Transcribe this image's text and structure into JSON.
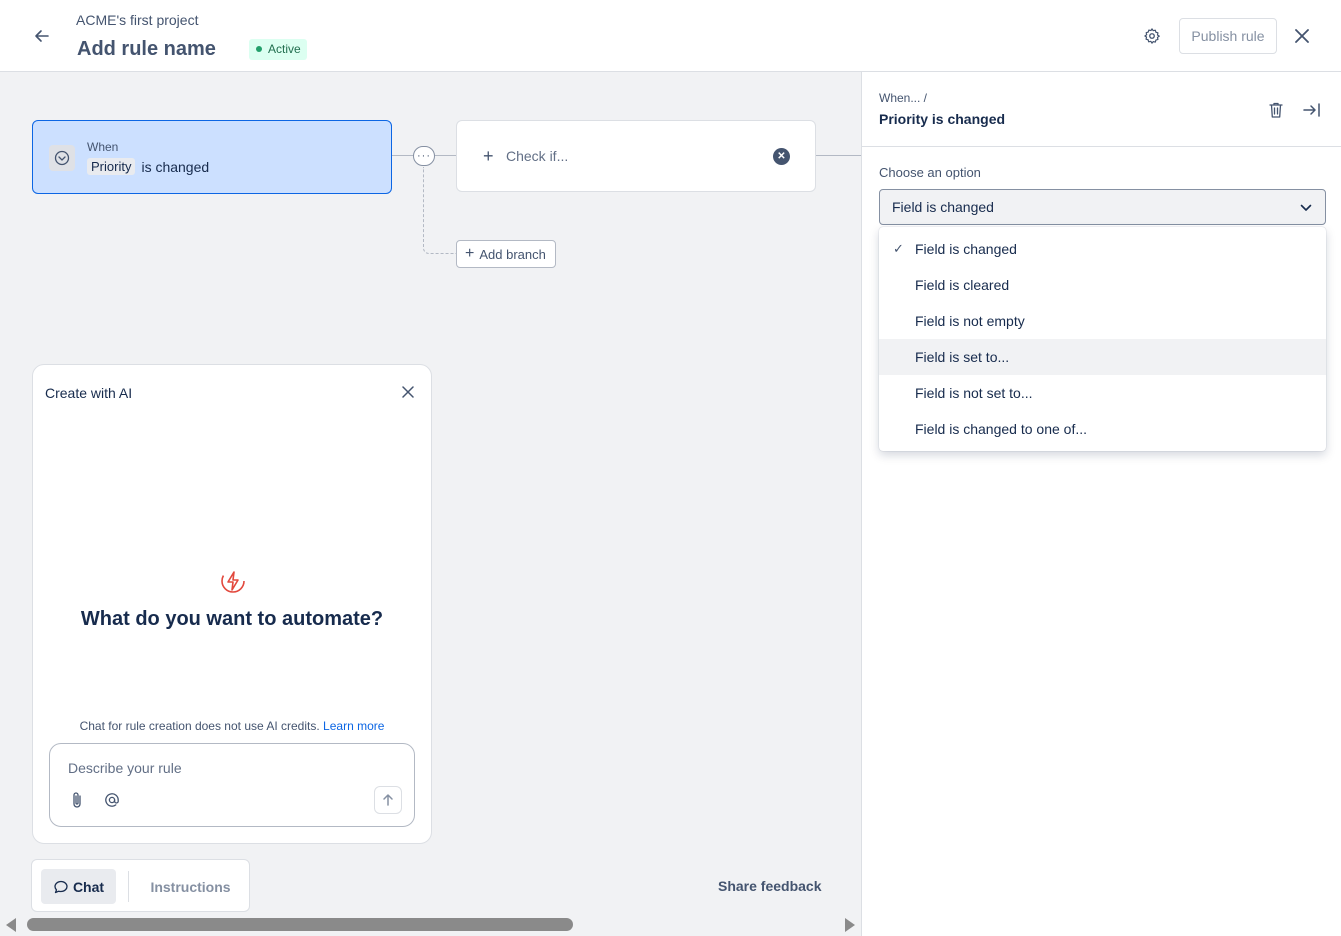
{
  "header": {
    "project": "ACME's first project",
    "rule_name": "Add rule name",
    "status": "Active",
    "publish_label": "Publish rule"
  },
  "canvas": {
    "trigger": {
      "when": "When",
      "field": "Priority",
      "action": "is changed"
    },
    "condition": {
      "label": "Check if..."
    },
    "add_branch_label": "Add branch",
    "more_label": "···"
  },
  "ai_panel": {
    "title": "Create with AI",
    "heading": "What do you want to automate?",
    "note": "Chat for rule creation does not use AI credits.",
    "learn_more": "Learn more",
    "input_placeholder": "Describe your rule"
  },
  "tabs": {
    "chat": "Chat",
    "instructions": "Instructions"
  },
  "share_feedback": "Share feedback",
  "right_panel": {
    "breadcrumb": "When...  /",
    "title": "Priority is changed",
    "option_label": "Choose an option",
    "selected": "Field is changed",
    "options": [
      {
        "label": "Field is changed",
        "selected": true
      },
      {
        "label": "Field is cleared",
        "selected": false
      },
      {
        "label": "Field is not empty",
        "selected": false
      },
      {
        "label": "Field is set to...",
        "selected": false,
        "hovered": true
      },
      {
        "label": "Field is not set to...",
        "selected": false
      },
      {
        "label": "Field is changed to one of...",
        "selected": false
      }
    ]
  },
  "colors": {
    "accent": "#0c66e4",
    "trigger_bg": "#cce0ff",
    "active_badge_bg": "#dcfff1",
    "active_badge_text": "#216e4e",
    "ai_logo": "#e2483d"
  }
}
